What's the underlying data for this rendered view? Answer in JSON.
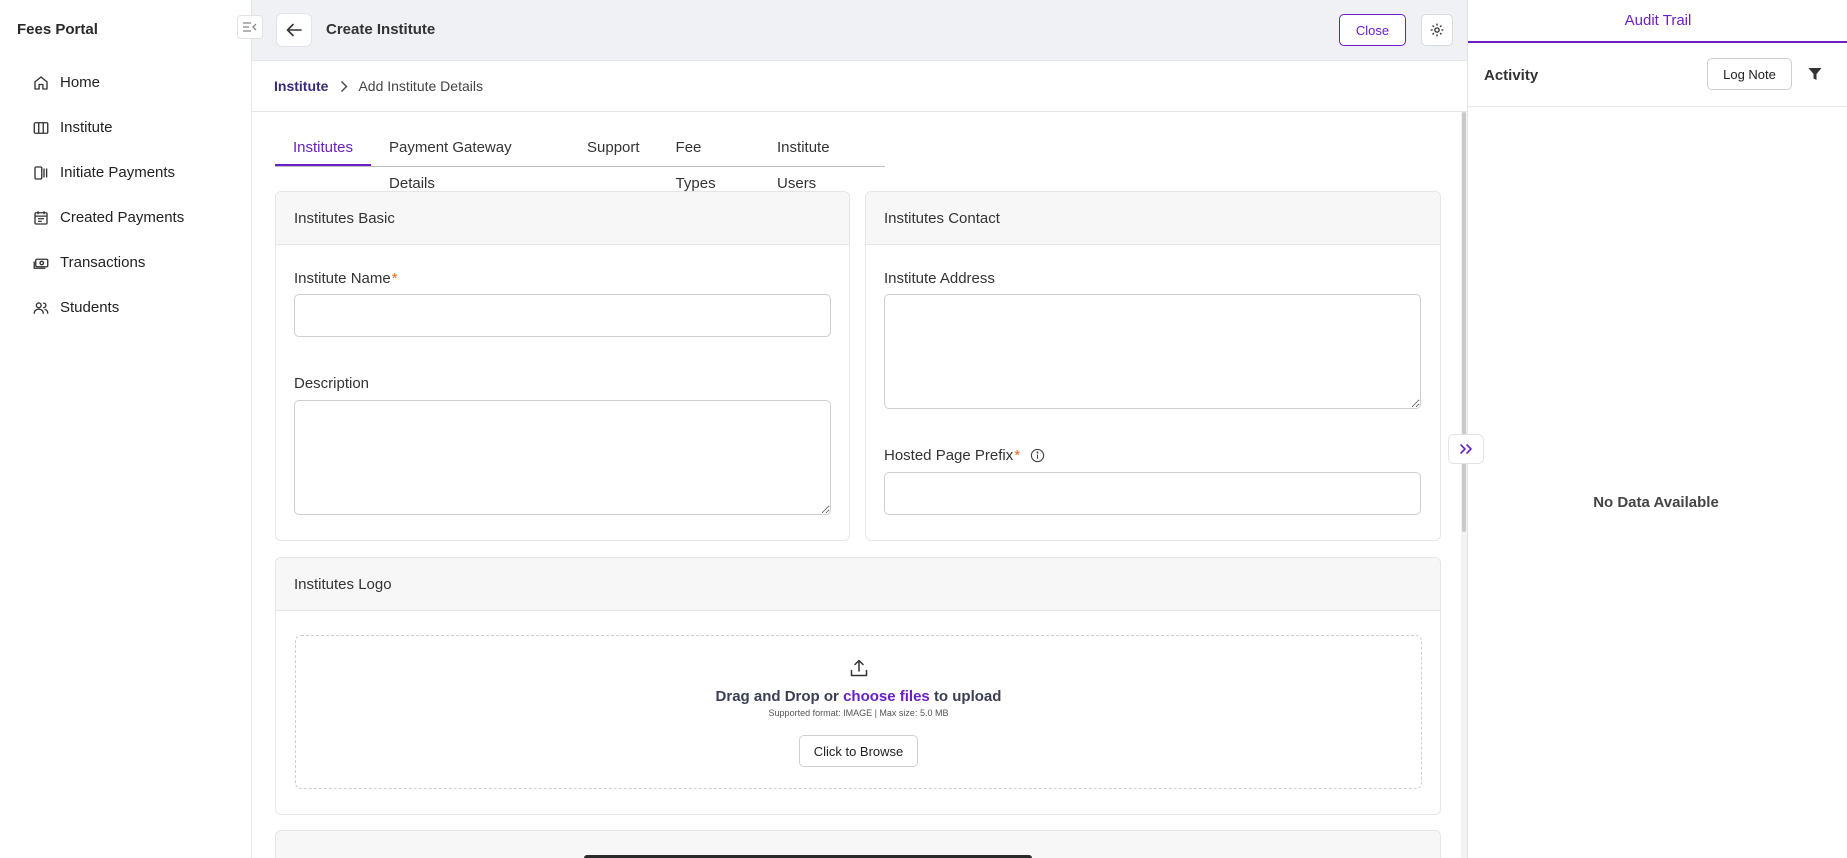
{
  "app": {
    "title": "Fees Portal"
  },
  "sidebar": {
    "items": [
      {
        "label": "Home",
        "icon": "home-icon"
      },
      {
        "label": "Institute",
        "icon": "columns-icon"
      },
      {
        "label": "Initiate Payments",
        "icon": "payments-icon"
      },
      {
        "label": "Created Payments",
        "icon": "calendar-icon"
      },
      {
        "label": "Transactions",
        "icon": "cash-icon"
      },
      {
        "label": "Students",
        "icon": "users-icon"
      }
    ]
  },
  "header": {
    "title": "Create Institute",
    "close_label": "Close"
  },
  "breadcrumb": {
    "parent": "Institute",
    "current": "Add Institute Details"
  },
  "tabs": [
    {
      "label": "Institutes",
      "active": true
    },
    {
      "label": "Payment Gateway Details",
      "active": false
    },
    {
      "label": "Support",
      "active": false
    },
    {
      "label": "Fee Types",
      "active": false
    },
    {
      "label": "Institute Users",
      "active": false
    }
  ],
  "basic": {
    "title": "Institutes Basic",
    "name_label": "Institute Name",
    "name_value": "",
    "description_label": "Description",
    "description_value": ""
  },
  "contact": {
    "title": "Institutes Contact",
    "address_label": "Institute Address",
    "address_value": "",
    "prefix_label": "Hosted Page Prefix",
    "prefix_value": ""
  },
  "required_mark": "*",
  "logo": {
    "title": "Institutes Logo",
    "drag_text": "Drag and Drop or",
    "choose_text": "choose files",
    "upload_text": "to upload",
    "supported": "Supported format: IMAGE | Max size: 5.0 MB",
    "browse_label": "Click to Browse"
  },
  "audit": {
    "tab_label": "Audit Trail",
    "activity_label": "Activity",
    "log_note_label": "Log Note",
    "empty_text": "No Data Available"
  },
  "colors": {
    "accent": "#6a1fc7",
    "required": "#e06a1a",
    "topbar": "#eff1f5"
  }
}
